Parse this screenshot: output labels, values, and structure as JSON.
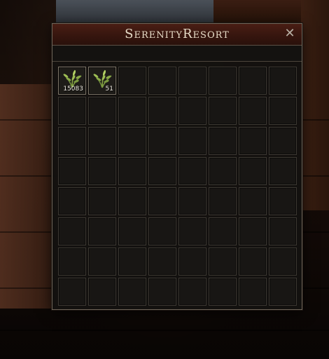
{
  "window": {
    "title": "SerenityResort",
    "close_label": "✕"
  },
  "inventory": {
    "columns": 8,
    "rows": 8,
    "items": [
      {
        "slot": 0,
        "icon": "herb-bundle-icon",
        "quantity": "15083"
      },
      {
        "slot": 1,
        "icon": "herb-bundle-icon",
        "quantity": "51"
      }
    ]
  }
}
